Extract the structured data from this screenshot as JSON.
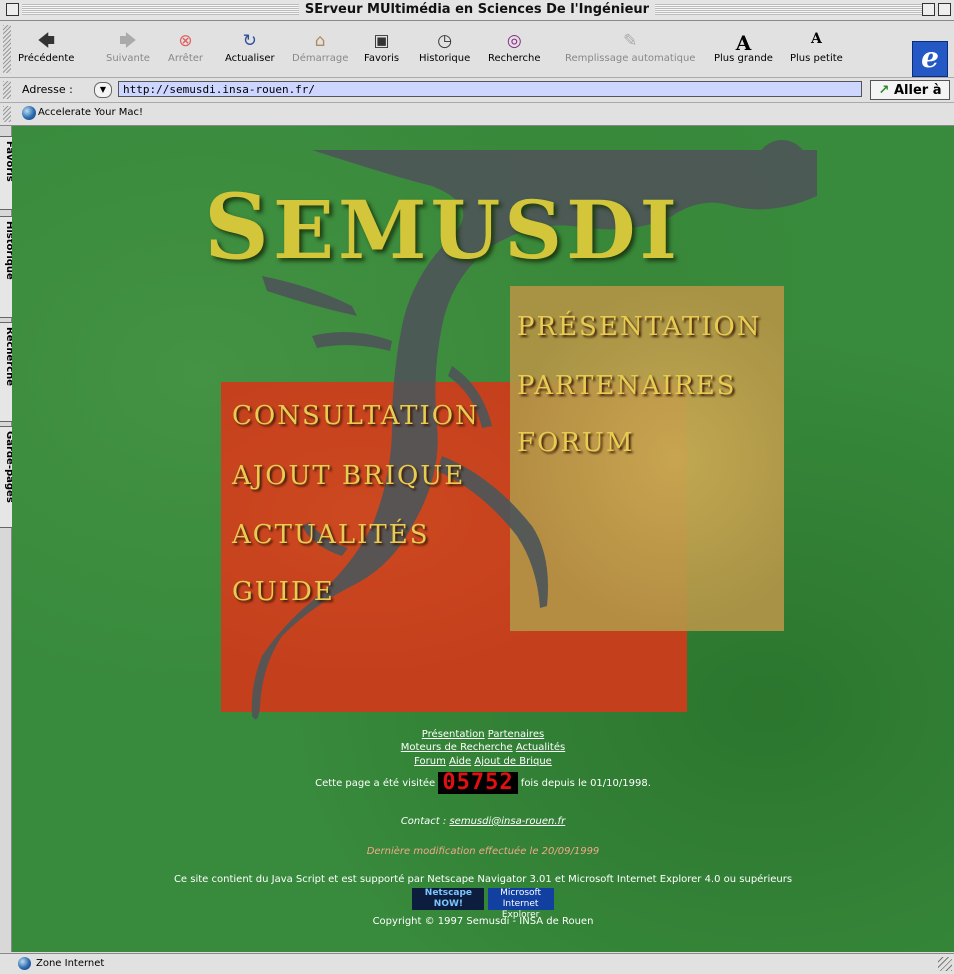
{
  "window": {
    "title": "SErveur MUltimédia en Sciences De l'Ingénieur"
  },
  "toolbar": {
    "buttons": [
      {
        "label": "Précédente",
        "icon": "back-arrow-icon",
        "enabled": true
      },
      {
        "label": "Suivante",
        "icon": "forward-arrow-icon",
        "enabled": false
      },
      {
        "label": "Arrêter",
        "icon": "stop-icon",
        "enabled": false
      },
      {
        "label": "Actualiser",
        "icon": "refresh-icon",
        "enabled": true
      },
      {
        "label": "Démarrage",
        "icon": "home-icon",
        "enabled": false
      },
      {
        "label": "Favoris",
        "icon": "favorites-icon",
        "enabled": true
      },
      {
        "label": "Historique",
        "icon": "history-icon",
        "enabled": true
      },
      {
        "label": "Recherche",
        "icon": "search-icon",
        "enabled": true
      },
      {
        "label": "Remplissage automatique",
        "icon": "autofill-icon",
        "enabled": false
      },
      {
        "label": "Plus grande",
        "icon": "larger-text-icon",
        "enabled": true
      },
      {
        "label": "Plus petite",
        "icon": "smaller-text-icon",
        "enabled": true
      }
    ],
    "brand_icon": "internet-explorer-logo"
  },
  "address": {
    "label": "Adresse :",
    "url": "http://semusdi.insa-rouen.fr/",
    "go_label": "Aller à"
  },
  "favorites_bar": {
    "item": "Accelerate Your Mac!"
  },
  "side_tabs": [
    "Favoris",
    "Historique",
    "Recherche",
    "Garde-pages"
  ],
  "page": {
    "logo": "SEMUSDI",
    "logo_first": "S",
    "logo_rest": "EMUSDI",
    "colors": {
      "background": "#388a3c",
      "red_panel": "#c43f1c",
      "gold_panel": "#b2944a",
      "menu_text": "#e8cc52"
    },
    "gold_menu": [
      "PRÉSENTATION",
      "PARTENAIRES",
      "FORUM"
    ],
    "red_menu": [
      "CONSULTATION",
      "AJOUT BRIQUE",
      "ACTUALITÉS",
      "GUIDE"
    ],
    "footer_links": {
      "row1": [
        "Présentation",
        "Partenaires"
      ],
      "row2": [
        "Moteurs de Recherche",
        "Actualités"
      ],
      "row3": [
        "Forum",
        "Aide",
        "Ajout de Brique"
      ]
    },
    "visits_prefix": "Cette page a été visitée",
    "visit_count": "05752",
    "visits_suffix": "fois depuis le 01/10/1998.",
    "contact_label": "Contact :",
    "contact_email": "semusdi@insa-rouen.fr",
    "last_modified": "Dernière modification effectuée le 20/09/1999",
    "compat_note": "Ce site contient du Java Script et est supporté par Netscape Navigator 3.01 et Microsoft Internet Explorer 4.0 ou supérieurs",
    "badges": {
      "netscape": "Netscape NOW!",
      "ie": "Microsoft Internet Explorer"
    },
    "copyright": "Copyright © 1997 Semusdi - INSA de Rouen"
  },
  "status_bar": {
    "zone": "Zone Internet"
  }
}
